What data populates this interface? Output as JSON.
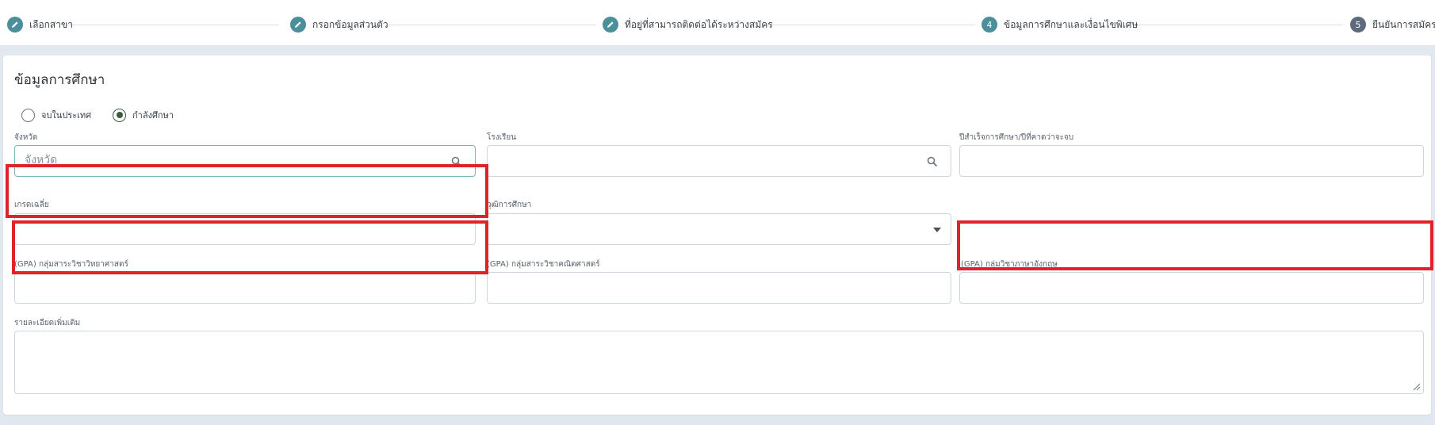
{
  "stepper": {
    "steps": [
      {
        "label": "เลือกสาขา",
        "marker": "pencil-icon",
        "state": "done"
      },
      {
        "label": "กรอกข้อมูลส่วนตัว",
        "marker": "pencil-icon",
        "state": "done"
      },
      {
        "label": "ที่อยู่ที่สามารถติดต่อได้ระหว่างสมัคร",
        "marker": "pencil-icon",
        "state": "done"
      },
      {
        "label": "ข้อมูลการศึกษาและเงื่อนไขพิเศษ",
        "number": "4",
        "state": "active"
      },
      {
        "label": "ยืนยันการสมัคร",
        "number": "5",
        "state": "pending"
      }
    ]
  },
  "section": {
    "title": "ข้อมูลการศึกษา"
  },
  "radios": [
    {
      "label": "จบในประเทศ",
      "checked": false
    },
    {
      "label": "กำลังศึกษา",
      "checked": true
    }
  ],
  "fields": {
    "province": {
      "label": "จังหวัด",
      "placeholder": "จังหวัด",
      "value": ""
    },
    "school": {
      "label": "โรงเรียน",
      "value": ""
    },
    "grad_year": {
      "label": "ปีสำเร็จการศึกษา/ปีที่คาดว่าจะจบ",
      "value": ""
    },
    "gpax": {
      "label": "เกรดเฉลี่ย",
      "value": ""
    },
    "qualification": {
      "label": "วุฒิการศึกษา",
      "value": ""
    },
    "gpa_science": {
      "label": "(GPA) กลุ่มสาระวิชาวิทยาศาสตร์",
      "value": ""
    },
    "gpa_math": {
      "label": "(GPA) กลุ่มสาระวิชาคณิตศาสตร์",
      "value": ""
    },
    "gpa_english": {
      "label": "(GPA) กลุ่มวิชาภาษาอังกฤษ",
      "value": ""
    },
    "details": {
      "label": "รายละเอียดเพิ่มเติม",
      "value": ""
    }
  },
  "colors": {
    "step_done": "#4a8f9a",
    "step_pending": "#5e6a7d",
    "highlight": "#e0232b",
    "radio_checked": "#3d5a40"
  }
}
